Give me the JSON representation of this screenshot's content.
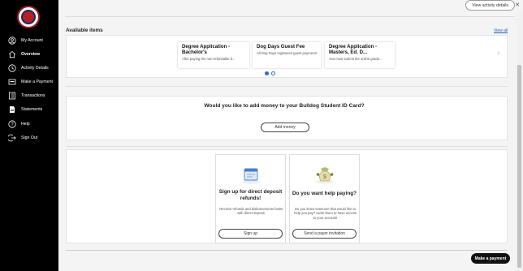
{
  "sidebar": {
    "items": [
      {
        "label": "My Account",
        "icon": "user-circle-icon"
      },
      {
        "label": "Overview",
        "icon": "home-icon"
      },
      {
        "label": "Activity Details",
        "icon": "clock-icon"
      },
      {
        "label": "Make a Payment",
        "icon": "payment-icon"
      },
      {
        "label": "Transactions",
        "icon": "transactions-icon"
      },
      {
        "label": "Statements",
        "icon": "document-icon"
      },
      {
        "label": "Help",
        "icon": "help-icon"
      },
      {
        "label": "Sign Out",
        "icon": "sign-out-icon"
      }
    ],
    "active": "Overview"
  },
  "header": {
    "activity_button": "View activity details"
  },
  "available": {
    "title": "Available items",
    "view_all": "View all",
    "items": [
      {
        "title": "Degree Application - Bachelor's",
        "desc": "After paying the non-refundable d..."
      },
      {
        "title": "Dog Days Guest Fee",
        "desc": "All Dog Days registered guest payments are re..."
      },
      {
        "title": "Degree Application - Masters, Ed. D...",
        "desc": "You must submit the online gradu..."
      }
    ]
  },
  "add_money": {
    "question": "Would you like to add money to your Bulldog Student ID Card?",
    "button": "Add money"
  },
  "promos": [
    {
      "title": "Sign up for direct deposit refunds!",
      "desc": "Receive refunds and disbursements faster with direct deposit.",
      "button": "Sign up",
      "icon": "direct-deposit-icon"
    },
    {
      "title": "Do you want help paying?",
      "desc": "Do you know someone that would like to help you pay? Invite them to have access to your account!",
      "button": "Send a payer invitation",
      "icon": "money-bag-icon"
    }
  ],
  "footer": {
    "pay_button": "Make a payment"
  },
  "colors": {
    "sidebar_bg": "#000000",
    "accent": "#2b6dd1",
    "logo_red": "#b32020"
  }
}
